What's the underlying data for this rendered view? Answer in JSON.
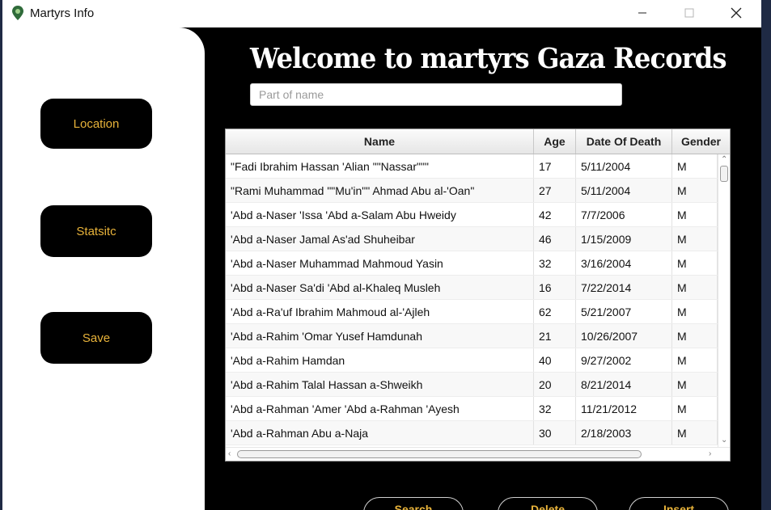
{
  "window": {
    "title": "Martyrs Info",
    "controls": [
      "minimize",
      "maximize",
      "close"
    ]
  },
  "sidebar": {
    "buttons": [
      "Location",
      "Statsitc",
      "Save"
    ]
  },
  "header": {
    "title": "Welcome to  martyrs Gaza Records"
  },
  "search": {
    "placeholder": "Part of name",
    "value": ""
  },
  "table": {
    "columns": [
      "Name",
      "Age",
      "Date Of Death",
      "Gender"
    ],
    "rows": [
      [
        "\"Fadi Ibrahim Hassan 'Alian \"\"Nassar\"\"\"",
        "17",
        "5/11/2004",
        "M"
      ],
      [
        "\"Rami Muhammad \"\"Mu'in\"\" Ahmad Abu al-'Oan\"",
        "27",
        "5/11/2004",
        "M"
      ],
      [
        "'Abd a-Naser 'Issa 'Abd a-Salam Abu Hweidy",
        "42",
        "7/7/2006",
        "M"
      ],
      [
        "'Abd a-Naser Jamal As'ad Shuheibar",
        "46",
        "1/15/2009",
        "M"
      ],
      [
        "'Abd a-Naser Muhammad Mahmoud Yasin",
        "32",
        "3/16/2004",
        "M"
      ],
      [
        "'Abd a-Naser Sa'di 'Abd al-Khaleq Musleh",
        "16",
        "7/22/2014",
        "M"
      ],
      [
        "'Abd a-Ra'uf Ibrahim Mahmoud al-'Ajleh",
        "62",
        "5/21/2007",
        "M"
      ],
      [
        "'Abd a-Rahim 'Omar Yusef Hamdunah",
        "21",
        "10/26/2007",
        "M"
      ],
      [
        "'Abd a-Rahim Hamdan",
        "40",
        "9/27/2002",
        "M"
      ],
      [
        "'Abd a-Rahim Talal Hassan a-Shweikh",
        "20",
        "8/21/2014",
        "M"
      ],
      [
        "'Abd a-Rahman 'Amer 'Abd a-Rahman 'Ayesh",
        "32",
        "11/21/2012",
        "M"
      ],
      [
        "'Abd a-Rahman Abu a-Naja",
        "30",
        "2/18/2003",
        "M"
      ]
    ]
  },
  "actions": {
    "search": "Search",
    "delete": "Delete",
    "insert": "Insert"
  },
  "colors": {
    "accent": "#e8b33a",
    "background": "#000000",
    "panel": "#ffffff"
  }
}
